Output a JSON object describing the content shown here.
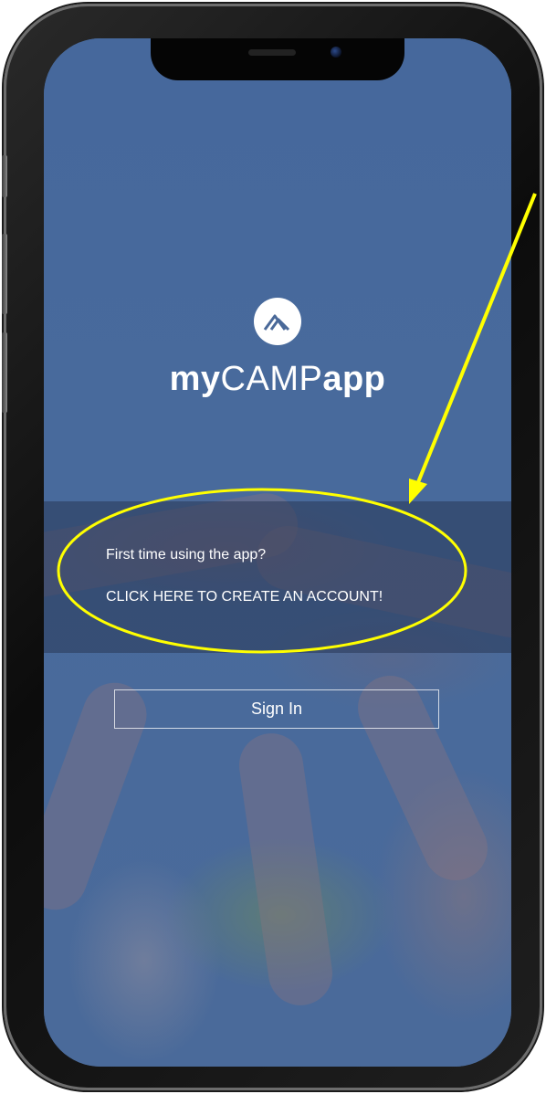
{
  "app": {
    "logo_icon": "mountain-logo-icon",
    "name_part_my": "my",
    "name_part_camp": "CAMP",
    "name_part_app": "app"
  },
  "banner": {
    "question": "First time using the app?",
    "create_account_link": "CLICK HERE TO CREATE AN ACCOUNT!"
  },
  "signin": {
    "label": "Sign In"
  },
  "annotation": {
    "color": "#ffff00",
    "shapes": [
      "arrow",
      "ellipse"
    ]
  },
  "colors": {
    "screen_background": "#4a6999",
    "text": "#ffffff"
  }
}
